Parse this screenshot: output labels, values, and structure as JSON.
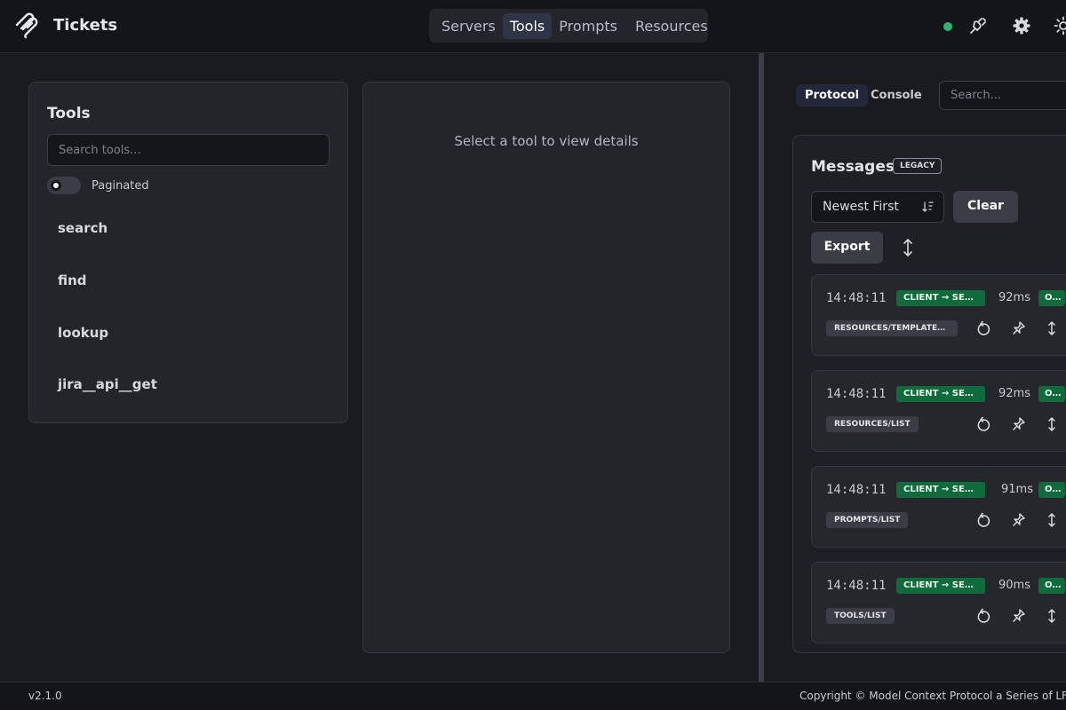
{
  "header": {
    "app_title": "Tickets",
    "tabs": [
      {
        "label": "Servers",
        "active": false
      },
      {
        "label": "Tools",
        "active": true
      },
      {
        "label": "Prompts",
        "active": false
      },
      {
        "label": "Resources",
        "active": false
      }
    ],
    "status_color": "#2bb673",
    "icons": [
      "plug-icon",
      "gear-icon",
      "sun-icon"
    ]
  },
  "tools": {
    "title": "Tools",
    "search_placeholder": "Search tools...",
    "paginated_label": "Paginated",
    "paginated_on": false,
    "items": [
      "search",
      "find",
      "lookup",
      "jira__api__get"
    ]
  },
  "details": {
    "empty_text": "Select a tool to view details"
  },
  "right_panel": {
    "tabs": [
      {
        "label": "Protocol",
        "active": true
      },
      {
        "label": "Console",
        "active": false
      }
    ],
    "search_placeholder": "Search...",
    "messages": {
      "title": "Messages",
      "badge": "LEGACY",
      "sort_value": "Newest First",
      "clear_label": "Clear",
      "export_label": "Export",
      "items": [
        {
          "time": "14:48:11",
          "direction": "CLIENT → SER…",
          "duration": "92ms",
          "status": "O…",
          "method": "RESOURCES/TEMPLATES…"
        },
        {
          "time": "14:48:11",
          "direction": "CLIENT → SER…",
          "duration": "92ms",
          "status": "O…",
          "method": "RESOURCES/LIST"
        },
        {
          "time": "14:48:11",
          "direction": "CLIENT → SERV…",
          "duration": "91ms",
          "status": "O…",
          "method": "PROMPTS/LIST"
        },
        {
          "time": "14:48:11",
          "direction": "CLIENT → SER…",
          "duration": "90ms",
          "status": "O…",
          "method": "TOOLS/LIST"
        }
      ]
    }
  },
  "footer": {
    "version": "v2.1.0",
    "copyright": "Copyright © Model Context Protocol a Series of LF Proje"
  }
}
